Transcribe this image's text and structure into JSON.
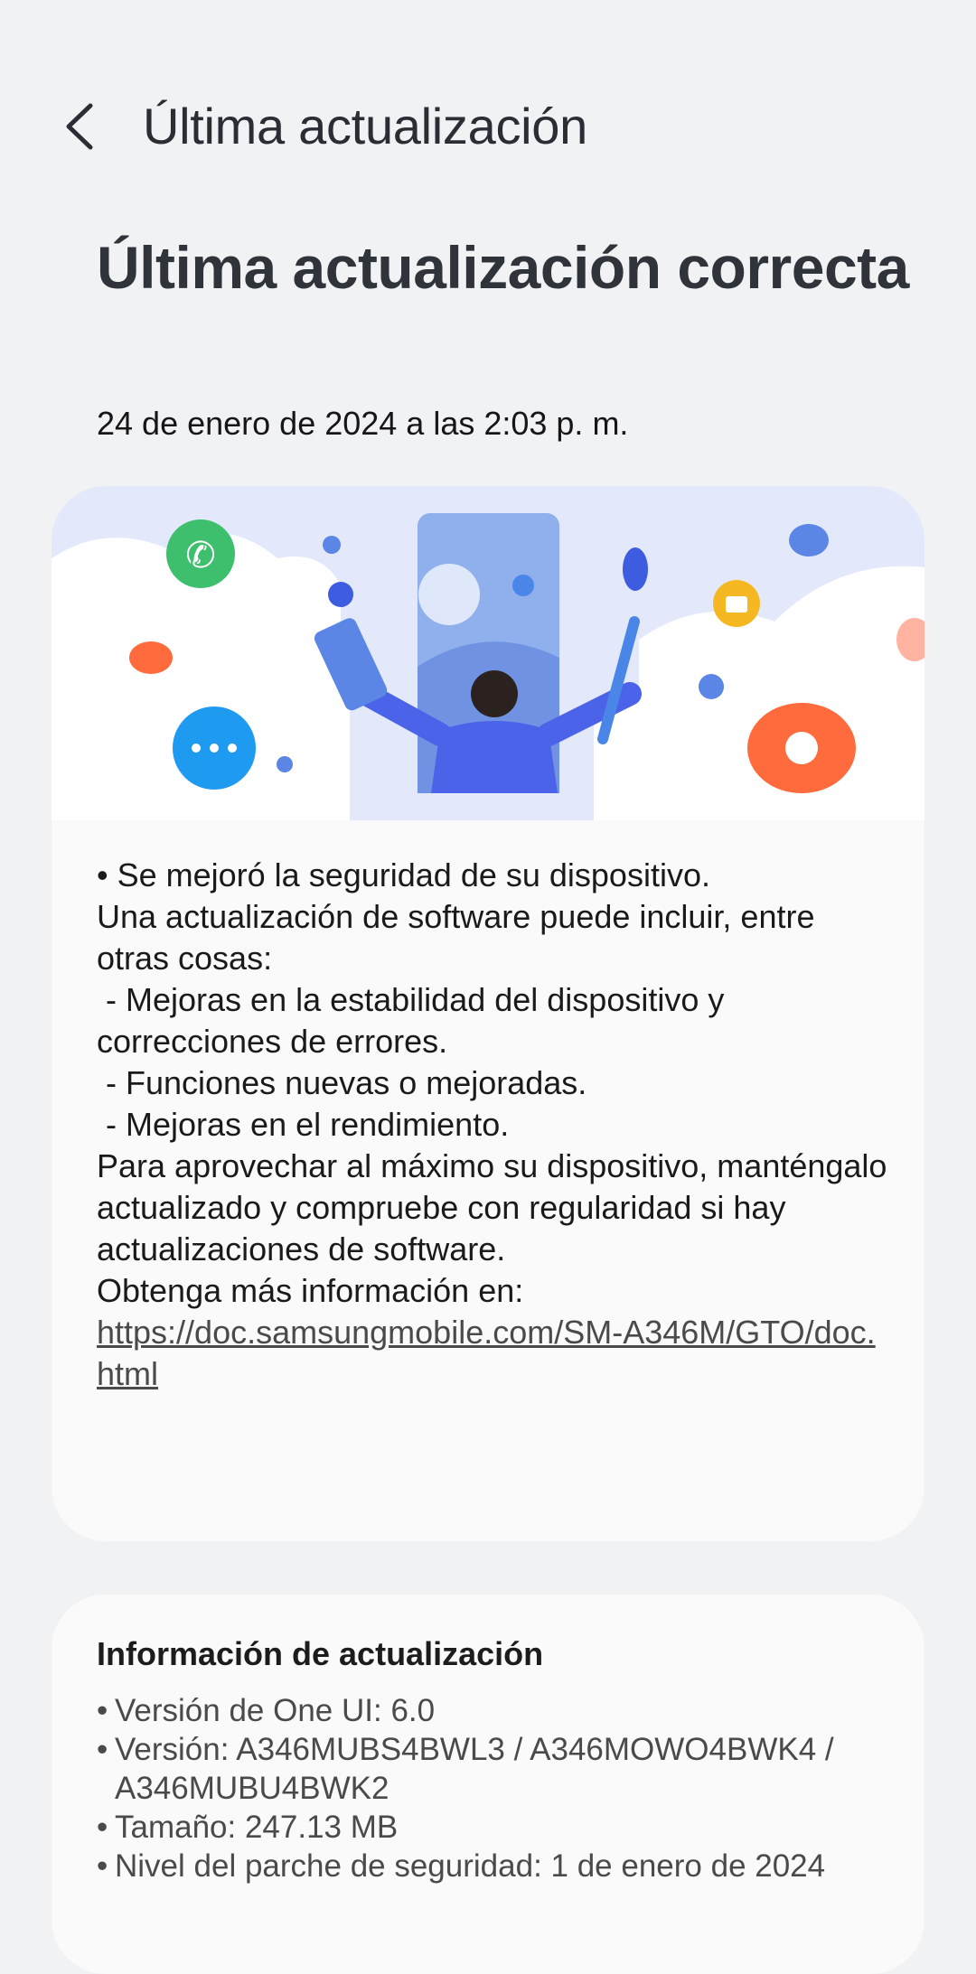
{
  "header": {
    "title": "Última actualización",
    "back_icon": "chevron-left-icon"
  },
  "status": {
    "headline": "Última actualización correcta",
    "date": "24 de enero de 2024 a las 2:03 p. m."
  },
  "release_notes": {
    "lines": [
      "• Se mejoró la seguridad de su dispositivo.",
      "",
      "Una actualización de software puede incluir, entre otras cosas:",
      " - Mejoras en la estabilidad del dispositivo y correcciones de errores.",
      " - Funciones nuevas o mejoradas.",
      " - Mejoras en el rendimiento.",
      "Para aprovechar al máximo su dispositivo, manténgalo actualizado y compruebe con regularidad si hay actualizaciones de software.",
      ""
    ],
    "more_info_label": "Obtenga más información en:",
    "link_text": "https://doc.samsungmobile.com/SM-A346M/GTO/doc.html"
  },
  "update_info": {
    "title": "Información de actualización",
    "items": [
      "Versión de One UI: 6.0",
      "Versión: A346MUBS4BWL3 / A346MOWO4BWK4 / A346MUBU4BWK2",
      "Tamaño: 247.13 MB",
      "Nivel del parche de seguridad: 1 de enero de 2024"
    ]
  },
  "colors": {
    "background": "#f1f2f4",
    "card": "#fafafa",
    "accent_blue": "#3d5ce0",
    "accent_orange": "#ff6b3d",
    "accent_green": "#3dbf6e",
    "accent_yellow": "#f6b822"
  }
}
